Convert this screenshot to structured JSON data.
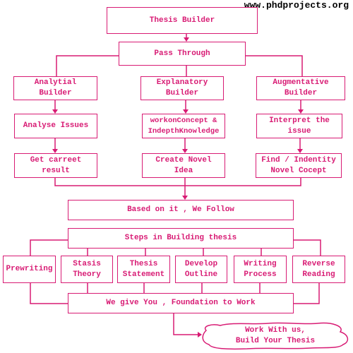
{
  "watermark": "www.phdprojects.org",
  "colors": {
    "accent": "#d81b74",
    "watermark": "#000000",
    "background": "#ffffff"
  },
  "nodes": {
    "thesis_builder": "Thesis Builder",
    "pass_through": "Pass Through",
    "analytial_builder": "Analytial\nBuilder",
    "explanatory_builder": "Explanatory\nBuilder",
    "augmentative_builder": "Augmentative\nBuilder",
    "analyse_issues": "Analyse Issues",
    "workon_concept": "workonConcept &\nIndepthKnowledge",
    "interpret_issue": "Interpret the\nissue",
    "get_result": "Get carreet\nresult",
    "create_idea": "Create Novel\nIdea",
    "find_concept": "Find / Indentity\nNovel Cocept",
    "based_on_it": "Based on it , We Follow",
    "steps": "Steps in Building thesis",
    "prewriting": "Prewriting",
    "stasis_theory": "Stasis\nTheory",
    "thesis_statement": "Thesis\nStatement",
    "develop_outline": "Develop\nOutline",
    "writing_process": "Writing\nProcess",
    "reverse_reading": "Reverse\nReading",
    "foundation": "We give You , Foundation to Work",
    "cloud": "Work With us,\nBuild Your Thesis"
  }
}
